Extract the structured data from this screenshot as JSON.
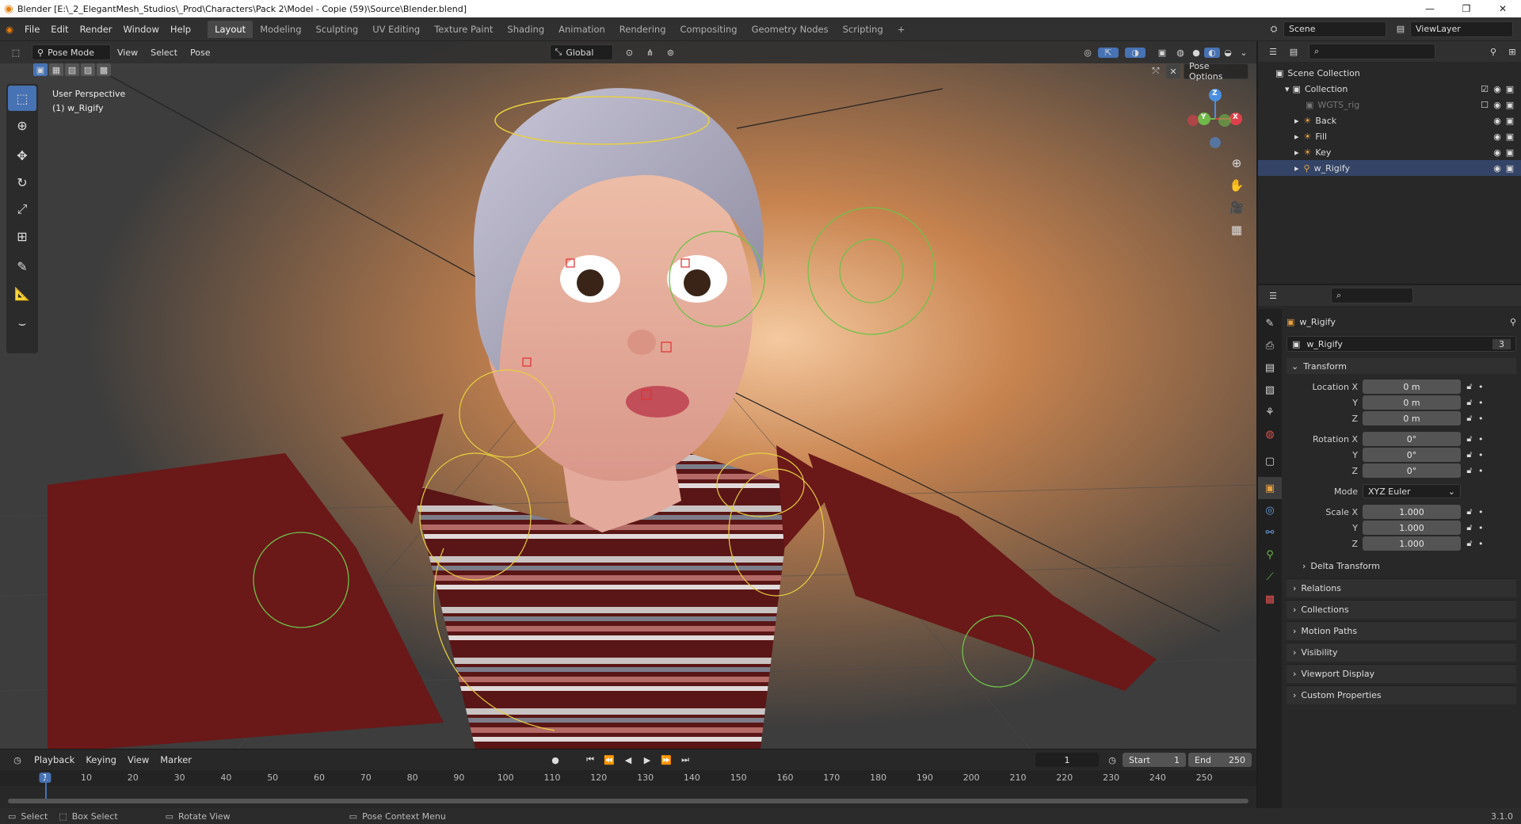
{
  "title_bar": {
    "title": "Blender [E:\\_2_ElegantMesh_Studios\\_Prod\\Characters\\Pack 2\\Model - Copie (59)\\Source\\Blender.blend]",
    "minimize": "—",
    "maximize": "❐",
    "close": "✕"
  },
  "menus": [
    "File",
    "Edit",
    "Render",
    "Window",
    "Help"
  ],
  "workspaces": [
    "Layout",
    "Modeling",
    "Sculpting",
    "UV Editing",
    "Texture Paint",
    "Shading",
    "Animation",
    "Rendering",
    "Compositing",
    "Geometry Nodes",
    "Scripting"
  ],
  "active_workspace": "Layout",
  "add_workspace": "+",
  "scene": {
    "label": "Scene",
    "viewlayer": "ViewLayer"
  },
  "viewport_header": {
    "mode": "Pose Mode",
    "menus": [
      "View",
      "Select",
      "Pose"
    ],
    "orientation": "Global",
    "pose_options": "Pose Options"
  },
  "viewport_overlay_text": {
    "line1": "User Perspective",
    "line2": "(1) w_Rigify"
  },
  "gizmo": {
    "z": "Z",
    "y": "Y",
    "x": "X"
  },
  "outliner": {
    "root": "Scene Collection",
    "collection": "Collection",
    "items": [
      {
        "name": "WGTS_rig",
        "dim": true
      },
      {
        "name": "Back"
      },
      {
        "name": "Fill"
      },
      {
        "name": "Key"
      },
      {
        "name": "w_Rigify"
      }
    ]
  },
  "properties": {
    "object_name": "w_Rigify",
    "data_name": "w_Rigify",
    "users": "3",
    "transform_title": "Transform",
    "location": [
      {
        "label": "Location X",
        "value": "0 m"
      },
      {
        "label": "Y",
        "value": "0 m"
      },
      {
        "label": "Z",
        "value": "0 m"
      }
    ],
    "rotation": [
      {
        "label": "Rotation X",
        "value": "0°"
      },
      {
        "label": "Y",
        "value": "0°"
      },
      {
        "label": "Z",
        "value": "0°"
      }
    ],
    "mode_label": "Mode",
    "mode_value": "XYZ Euler",
    "scale": [
      {
        "label": "Scale X",
        "value": "1.000"
      },
      {
        "label": "Y",
        "value": "1.000"
      },
      {
        "label": "Z",
        "value": "1.000"
      }
    ],
    "delta_transform": "Delta Transform",
    "panels": [
      "Relations",
      "Collections",
      "Motion Paths",
      "Visibility",
      "Viewport Display",
      "Custom Properties"
    ]
  },
  "timeline": {
    "menus": [
      "Playback",
      "Keying",
      "View",
      "Marker"
    ],
    "current_frame": "1",
    "start_label": "Start",
    "start": "1",
    "end_label": "End",
    "end": "250",
    "ticks": [
      "1",
      "10",
      "20",
      "30",
      "40",
      "50",
      "60",
      "70",
      "80",
      "90",
      "100",
      "110",
      "120",
      "130",
      "140",
      "150",
      "160",
      "170",
      "180",
      "190",
      "200",
      "210",
      "220",
      "230",
      "240",
      "250"
    ]
  },
  "status_bar": {
    "select": "Select",
    "box_select": "Box Select",
    "rotate_view": "Rotate View",
    "context_menu": "Pose Context Menu",
    "version": "3.1.0"
  },
  "colors": {
    "accent": "#4772b3",
    "x_axis": "#e0404d",
    "y_axis": "#6fb84a",
    "z_axis": "#4a8fe0"
  }
}
